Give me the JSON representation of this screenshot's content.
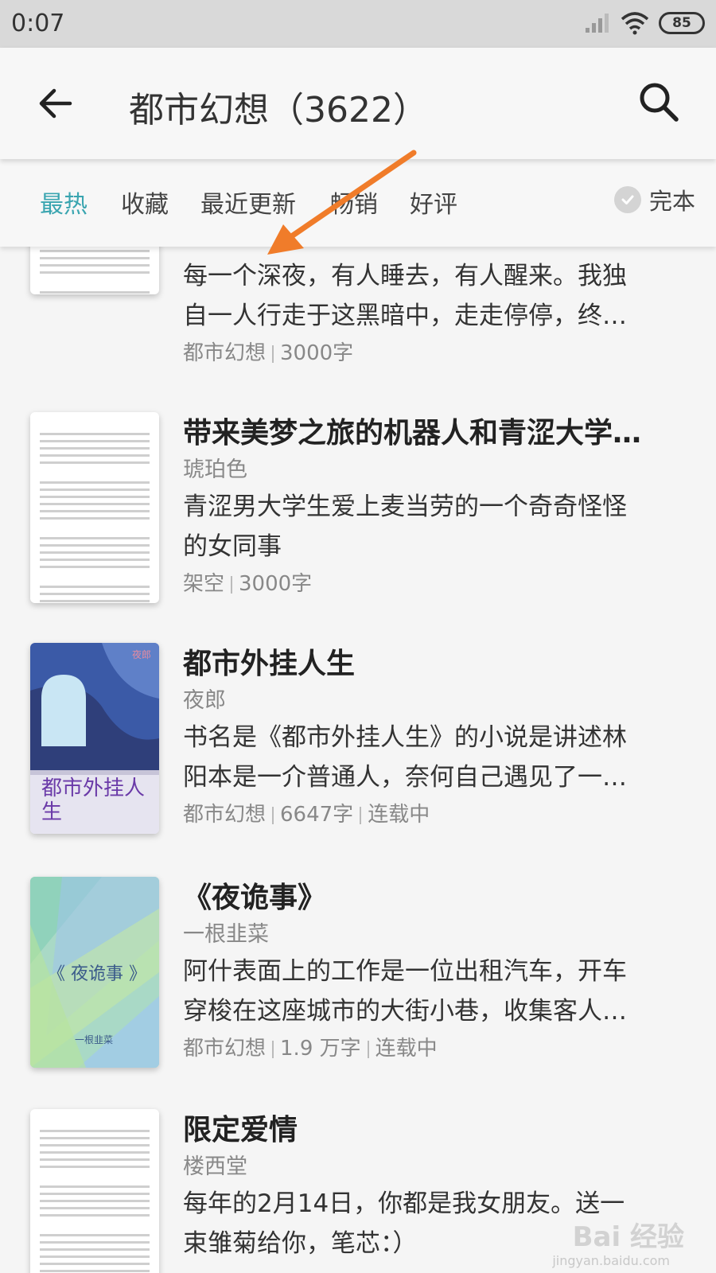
{
  "status_bar": {
    "time": "0:07",
    "battery": "85"
  },
  "header": {
    "title": "都市幻想（3622）"
  },
  "tabs": [
    {
      "label": "最热",
      "active": true
    },
    {
      "label": "收藏",
      "active": false
    },
    {
      "label": "最近更新",
      "active": false
    },
    {
      "label": "畅销",
      "active": false
    },
    {
      "label": "好评",
      "active": false
    }
  ],
  "filter": {
    "finished_label": "完本"
  },
  "books": [
    {
      "title": "",
      "author": "",
      "desc_line1": "每一个深夜，有人睡去，有人醒来。我独",
      "desc_line2": "自一人行走于这黑暗中，走走停停，终…",
      "category": "都市幻想",
      "words": "3000字",
      "status": ""
    },
    {
      "title": "带来美梦之旅的机器人和青涩大学…",
      "author": "琥珀色",
      "desc_line1": "青涩男大学生爱上麦当劳的一个奇奇怪怪",
      "desc_line2": "的女同事",
      "category": "架空",
      "words": "3000字",
      "status": ""
    },
    {
      "title": "都市外挂人生",
      "author": "夜郎",
      "desc_line1": "书名是《都市外挂人生》的小说是讲述林",
      "desc_line2": "阳本是一介普通人，奈何自己遇见了一…",
      "category": "都市幻想",
      "words": "6647字",
      "status": "连载中",
      "cover_title": "都市外挂人生",
      "cover_author": "夜郎"
    },
    {
      "title": "《夜诡事》",
      "author": "一根韭菜",
      "desc_line1": "阿什表面上的工作是一位出租汽车，开车",
      "desc_line2": "穿梭在这座城市的大街小巷，收集客人…",
      "category": "都市幻想",
      "words": "1.9 万字",
      "status": "连载中",
      "cover_title": "《 夜诡事 》",
      "cover_author": "一根韭菜"
    },
    {
      "title": "限定爱情",
      "author": "楼西堂",
      "desc_line1": "每年的2月14日，你都是我女朋友。送一",
      "desc_line2": "束雏菊给你，笔芯：）",
      "category": "",
      "words": "",
      "status": ""
    }
  ],
  "watermark": {
    "main": "Bai 经验",
    "sub": "jingyan.baidu.com"
  },
  "colors": {
    "accent": "#3aa5b0",
    "arrow": "#f07c2a"
  }
}
